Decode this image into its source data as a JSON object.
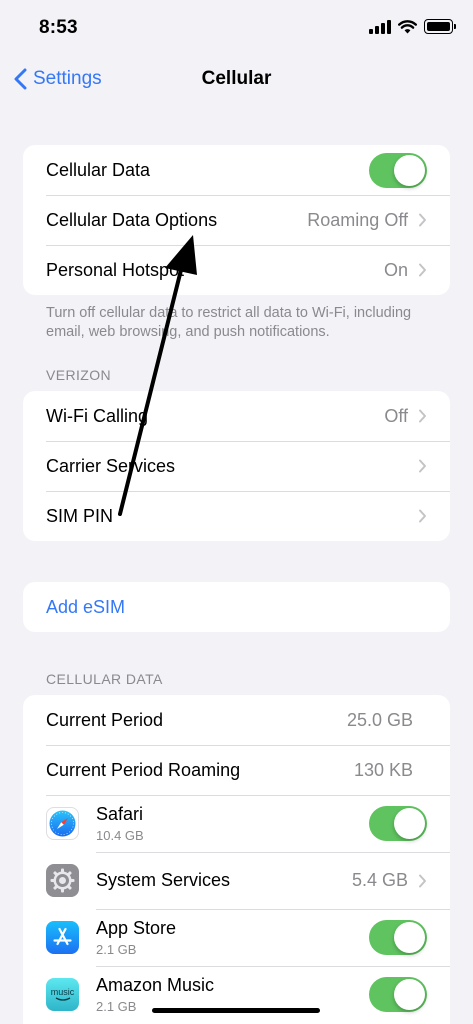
{
  "status_bar": {
    "time": "8:53"
  },
  "nav": {
    "back_label": "Settings",
    "title": "Cellular"
  },
  "group1": {
    "cellular_data": {
      "label": "Cellular Data",
      "toggle": true
    },
    "cellular_data_options": {
      "label": "Cellular Data Options",
      "value": "Roaming Off"
    },
    "personal_hotspot": {
      "label": "Personal Hotspot",
      "value": "On"
    }
  },
  "footnote": "Turn off cellular data to restrict all data to Wi-Fi, including email, web browsing, and push notifications.",
  "verizon": {
    "header": "VERIZON",
    "wifi_calling": {
      "label": "Wi-Fi Calling",
      "value": "Off"
    },
    "carrier_services": {
      "label": "Carrier Services"
    },
    "sim_pin": {
      "label": "SIM PIN"
    }
  },
  "add_esim": {
    "label": "Add eSIM"
  },
  "cellular_data_section": {
    "header": "CELLULAR DATA",
    "current_period": {
      "label": "Current Period",
      "value": "25.0 GB"
    },
    "current_period_roaming": {
      "label": "Current Period Roaming",
      "value": "130 KB"
    },
    "apps": [
      {
        "name": "Safari",
        "usage": "10.4 GB",
        "icon": "safari-compass-icon",
        "toggle": true
      },
      {
        "name": "System Services",
        "value": "5.4 GB",
        "icon": "gear-icon"
      },
      {
        "name": "App Store",
        "usage": "2.1 GB",
        "icon": "app-store-icon",
        "toggle": true
      },
      {
        "name": "Amazon Music",
        "usage": "2.1 GB",
        "icon": "amazon-music-icon",
        "icon_text": "music",
        "toggle": true
      }
    ]
  },
  "colors": {
    "accent": "#3478f6",
    "toggle_on": "#5fc35f",
    "background": "#f2f2f7",
    "secondary_text": "#8a8a8e"
  }
}
